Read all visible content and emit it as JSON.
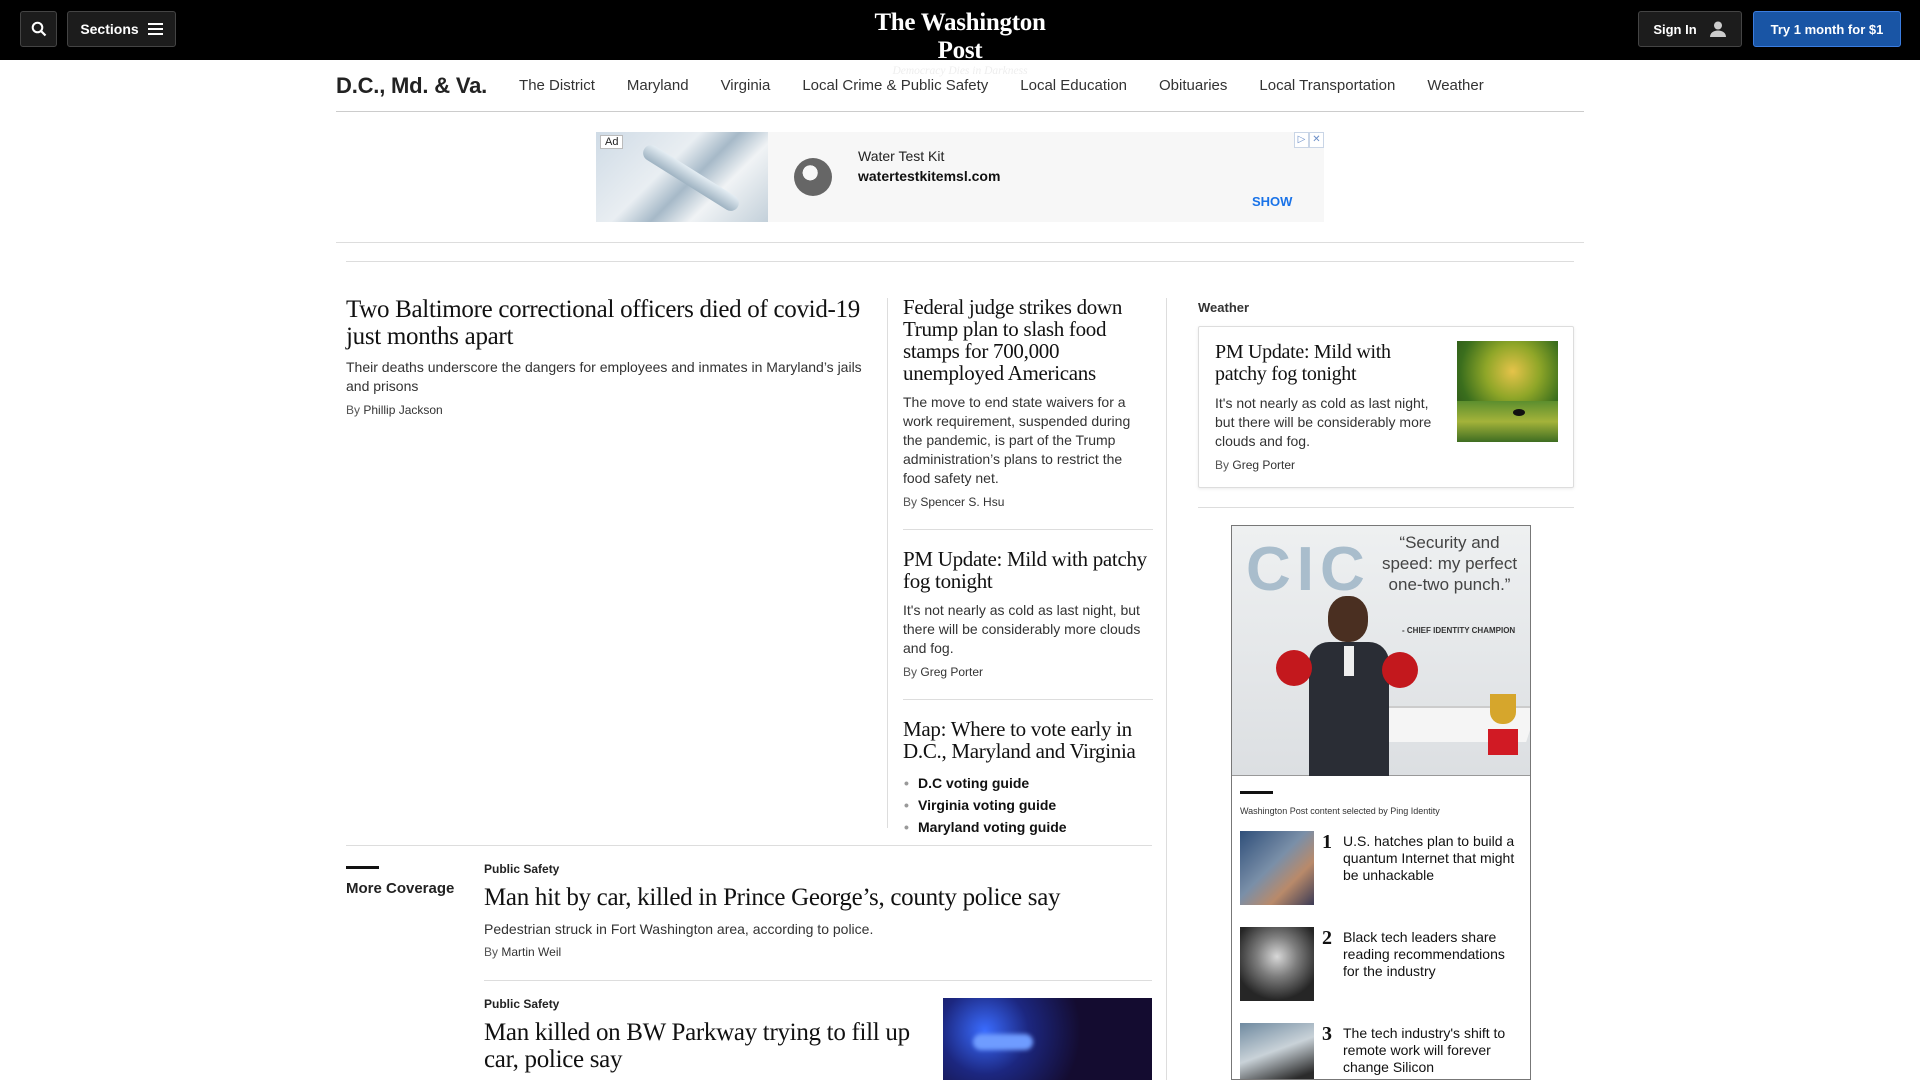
{
  "header": {
    "logo_name": "The Washington Post",
    "logo_tagline": "Democracy Dies in Darkness",
    "sections_label": "Sections",
    "signin_label": "Sign In",
    "subscribe_label": "Try 1 month for $1"
  },
  "section_nav": {
    "title": "D.C., Md. & Va.",
    "items": [
      "The District",
      "Maryland",
      "Virginia",
      "Local Crime & Public Safety",
      "Local Education",
      "Obituaries",
      "Local Transportation",
      "Weather"
    ]
  },
  "ad": {
    "label": "Ad",
    "title": "Water Test Kit",
    "url": "watertestkitemsl.com",
    "cta": "SHOW"
  },
  "main_story": {
    "headline": "Two Baltimore correctional officers died of covid-19 just months apart",
    "dek": "Their deaths underscore the dangers for employees and inmates in Maryland’s jails and prisons",
    "by": "By",
    "author": "Phillip Jackson"
  },
  "mid_stories": [
    {
      "headline": "Federal judge strikes down Trump plan to slash food stamps for 700,000 unemployed Americans",
      "dek": "The move to end state waivers for a work requirement, suspended during the pandemic, is part of the Trump administration’s plans to restrict the food safety net.",
      "by": "By",
      "author": "Spencer S. Hsu"
    },
    {
      "headline": "PM Update: Mild with patchy fog tonight",
      "dek": "It's not nearly as cold as last night, but there will be considerably more clouds and fog.",
      "by": "By",
      "author": "Greg Porter"
    }
  ],
  "voting": {
    "headline": "Map: Where to vote early in D.C., Maryland and Virginia",
    "links": [
      "D.C voting guide",
      "Virginia voting guide",
      "Maryland voting guide"
    ]
  },
  "rail": {
    "label": "Weather",
    "weather": {
      "headline": "PM Update: Mild with patchy fog tonight",
      "dek": "It's not nearly as cold as last night, but there will be considerably more clouds and fog.",
      "by": "By",
      "author": "Greg Porter"
    }
  },
  "sponsor": {
    "logo": "CIC",
    "quote": "“Security and speed: my perfect one-two punch.”",
    "attribution": "- CHIEF IDENTITY CHAMPION",
    "note": "Washington Post content selected by Ping Identity",
    "items": [
      {
        "num": "1",
        "text": "U.S. hatches plan to build a quantum Internet that might be unhackable"
      },
      {
        "num": "2",
        "text": "Black tech leaders share reading recommendations for the industry"
      },
      {
        "num": "3",
        "text": "The tech industry's shift to remote work will forever change Silicon"
      }
    ]
  },
  "more_coverage": {
    "label": "More Coverage",
    "stories": [
      {
        "kicker": "Public Safety",
        "headline": "Man hit by car, killed in Prince George’s, county police say",
        "dek": "Pedestrian struck in Fort Washington area, according to police.",
        "by": "By",
        "author": "Martin Weil"
      },
      {
        "kicker": "Public Safety",
        "headline": "Man killed on BW Parkway trying to fill up car, police say"
      }
    ]
  }
}
